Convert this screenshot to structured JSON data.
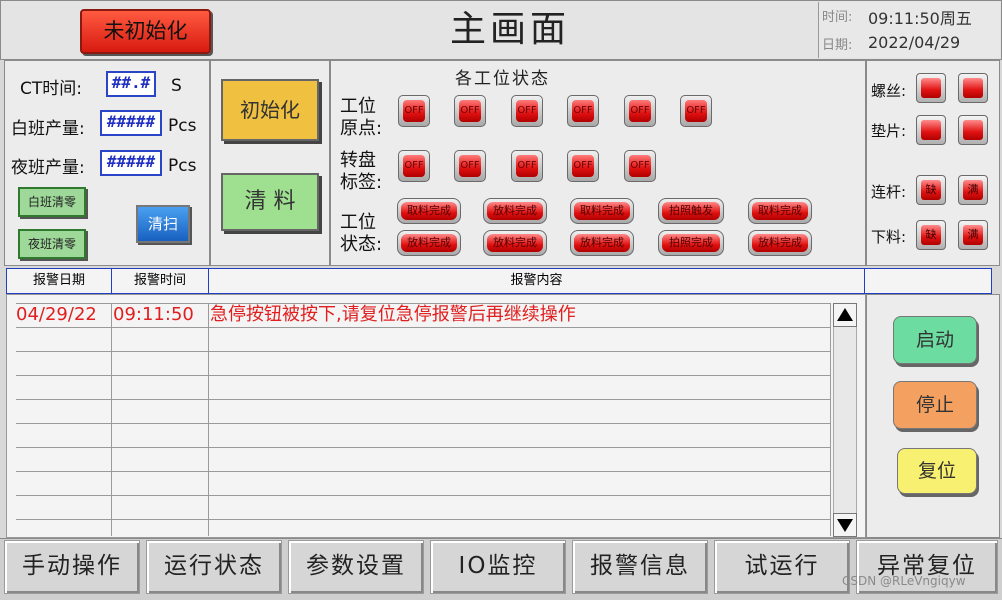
{
  "header": {
    "status_button": "未初始化",
    "title": "主画面",
    "time_label": "时间:",
    "time_value": "09:11:50周五",
    "date_label": "日期:",
    "date_value": "2022/04/29"
  },
  "production": {
    "ct_label": "CT时间:",
    "ct_value": "##.#",
    "ct_unit": "S",
    "day_label": "白班产量:",
    "day_value": "#####",
    "day_unit": "Pcs",
    "night_label": "夜班产量:",
    "night_value": "#####",
    "night_unit": "Pcs",
    "day_clear": "白班清零",
    "night_clear": "夜班清零",
    "cleanup_icon_label": "清扫"
  },
  "actions": {
    "init": "初始化",
    "clear_material": "清 料"
  },
  "stations": {
    "title": "各工位状态",
    "origin_label_1": "工位",
    "origin_label_2": "原点:",
    "turntable_label_1": "转盘",
    "turntable_label_2": "标签:",
    "state_label_1": "工位",
    "state_label_2": "状态:",
    "origin_lamps": [
      "OFF",
      "OFF",
      "OFF",
      "OFF",
      "OFF",
      "OFF"
    ],
    "turntable_lamps": [
      "OFF",
      "OFF",
      "OFF",
      "OFF",
      "OFF"
    ],
    "state_row1": [
      "取料完成",
      "放料完成",
      "取料完成",
      "拍照触发",
      "取料完成"
    ],
    "state_row2": [
      "放料完成",
      "放料完成",
      "放料完成",
      "拍照完成",
      "放料完成"
    ]
  },
  "feeders": {
    "screw_label": "螺丝:",
    "gasket_label": "垫片:",
    "link_label": "连杆:",
    "unload_label": "下料:",
    "short": "缺",
    "full": "满"
  },
  "alarm_table": {
    "headers": [
      "报警日期",
      "报警时间",
      "报警内容"
    ],
    "rows": [
      {
        "date": "04/29/22",
        "time": "09:11:50",
        "content": "急停按钮被按下,请复位急停报警后再继续操作"
      }
    ]
  },
  "controls": {
    "start": "启动",
    "stop": "停止",
    "reset": "复位"
  },
  "nav": [
    "手动操作",
    "运行状态",
    "参数设置",
    "IO监控",
    "报警信息",
    "试运行",
    "异常复位"
  ],
  "watermark": "CSDN @RLeVngiqyw",
  "colors": {
    "status_red": "#e8281c",
    "init_yellow": "#f0c040",
    "clear_green": "#9ee090",
    "start_green": "#6cdca0",
    "stop_orange": "#f4a060",
    "reset_yellow": "#f8f070",
    "alarm_text": "#e02020"
  }
}
